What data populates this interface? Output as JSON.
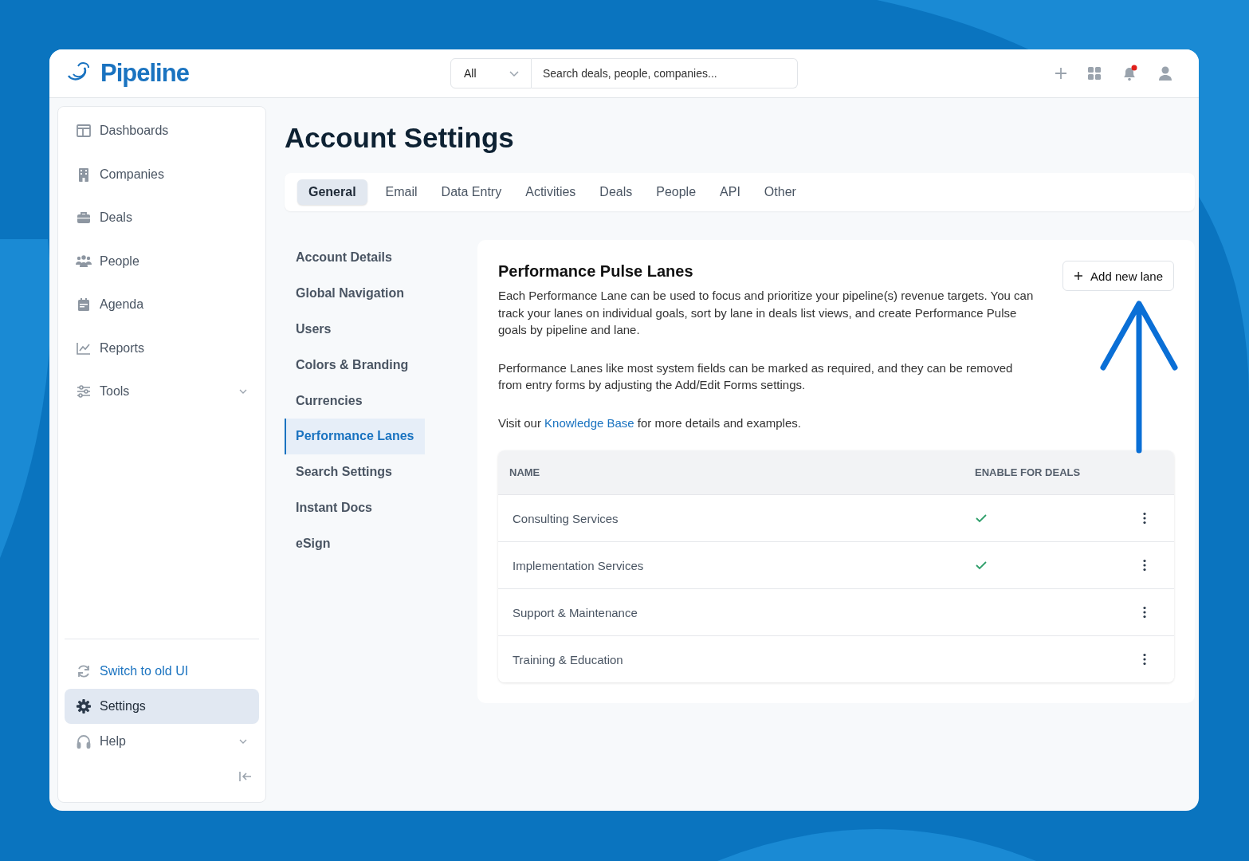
{
  "brand": "Pipeline",
  "search": {
    "scope": "All",
    "placeholder": "Search deals, people, companies..."
  },
  "header": {
    "notification_dot": true
  },
  "sidebar": {
    "items": [
      {
        "label": "Dashboards",
        "selected": false
      },
      {
        "label": "Companies",
        "selected": false
      },
      {
        "label": "Deals",
        "selected": false
      },
      {
        "label": "People",
        "selected": false
      },
      {
        "label": "Agenda",
        "selected": false
      },
      {
        "label": "Reports",
        "selected": false
      },
      {
        "label": "Tools",
        "selected": false,
        "expanded": false
      }
    ],
    "bottom_items": [
      {
        "label": "Switch to old UI",
        "kind": "link",
        "selected": false
      },
      {
        "label": "Settings",
        "kind": "item",
        "selected": true
      },
      {
        "label": "Help",
        "kind": "item",
        "selected": false,
        "expanded": false
      }
    ]
  },
  "page_title": "Account Settings",
  "tabs": [
    {
      "label": "General",
      "selected": true
    },
    {
      "label": "Email",
      "selected": false
    },
    {
      "label": "Data Entry",
      "selected": false
    },
    {
      "label": "Activities",
      "selected": false
    },
    {
      "label": "Deals",
      "selected": false
    },
    {
      "label": "People",
      "selected": false
    },
    {
      "label": "API",
      "selected": false
    },
    {
      "label": "Other",
      "selected": false
    }
  ],
  "submenu": [
    {
      "label": "Account Details",
      "selected": false
    },
    {
      "label": "Global Navigation",
      "selected": false
    },
    {
      "label": "Users",
      "selected": false
    },
    {
      "label": "Colors & Branding",
      "selected": false
    },
    {
      "label": "Currencies",
      "selected": false
    },
    {
      "label": "Performance Lanes",
      "selected": true
    },
    {
      "label": "Search Settings",
      "selected": false
    },
    {
      "label": "Instant Docs",
      "selected": false
    },
    {
      "label": "eSign",
      "selected": false
    }
  ],
  "card": {
    "title": "Performance Pulse Lanes",
    "add_button": "Add new lane",
    "paragraphs": [
      "Each Performance Lane can be used to focus and prioritize your pipeline(s) revenue targets. You can track your lanes on individual goals, sort by lane in deals list views, and create Performance Pulse goals by pipeline and lane.",
      "Performance Lanes like most system fields can be marked as required, and they can be removed from entry forms by adjusting the Add/Edit Forms settings."
    ],
    "link_paragraph": {
      "before": "Visit our ",
      "link": "Knowledge Base",
      "after": " for more details and examples."
    },
    "table": {
      "columns": [
        "NAME",
        "ENABLE FOR DEALS"
      ],
      "rows": [
        {
          "name": "Consulting Services",
          "enabled": true
        },
        {
          "name": "Implementation Services",
          "enabled": true
        },
        {
          "name": "Support & Maintenance",
          "enabled": false
        },
        {
          "name": "Training & Education",
          "enabled": false
        }
      ]
    }
  }
}
